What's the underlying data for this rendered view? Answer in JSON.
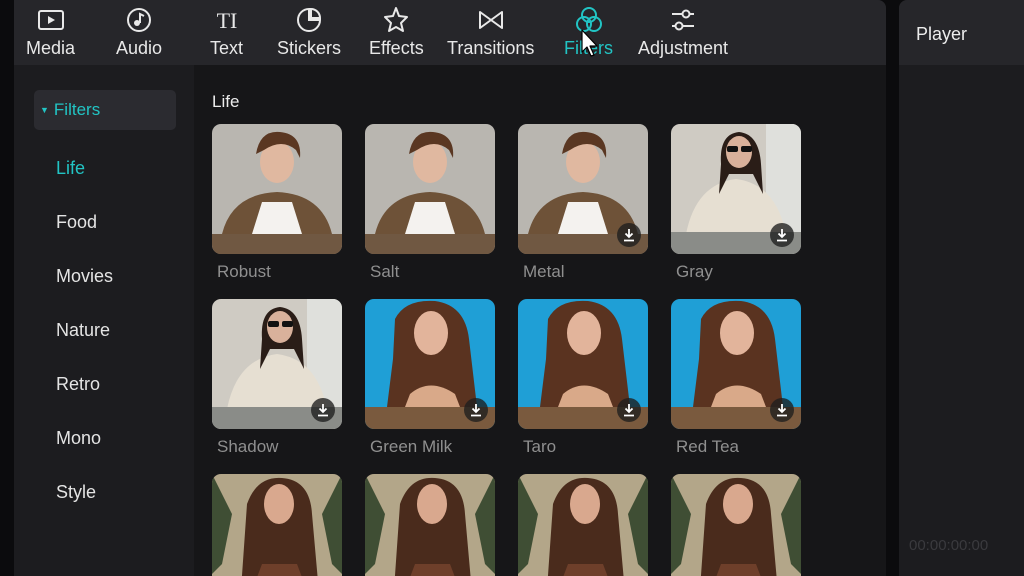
{
  "toolbar": {
    "tabs": [
      {
        "label": "Media",
        "icon": "media-icon"
      },
      {
        "label": "Audio",
        "icon": "audio-icon"
      },
      {
        "label": "Text",
        "icon": "text-icon"
      },
      {
        "label": "Stickers",
        "icon": "stickers-icon"
      },
      {
        "label": "Effects",
        "icon": "effects-icon"
      },
      {
        "label": "Transitions",
        "icon": "transitions-icon"
      },
      {
        "label": "Filters",
        "icon": "filters-icon",
        "active": true
      },
      {
        "label": "Adjustment",
        "icon": "adjustment-icon"
      }
    ],
    "text_icon_glyph": "TI"
  },
  "sidebar": {
    "header": "Filters",
    "items": [
      "Life",
      "Food",
      "Movies",
      "Nature",
      "Retro",
      "Mono",
      "Style"
    ],
    "active": "Life"
  },
  "content": {
    "section_title": "Life",
    "filters": [
      {
        "name": "Robust",
        "download": false
      },
      {
        "name": "Salt",
        "download": false
      },
      {
        "name": "Metal",
        "download": true
      },
      {
        "name": "Gray",
        "download": true
      },
      {
        "name": "Shadow",
        "download": true
      },
      {
        "name": "Green Milk",
        "download": true
      },
      {
        "name": "Taro",
        "download": true
      },
      {
        "name": "Red Tea",
        "download": true
      },
      {
        "name": "",
        "download": false
      },
      {
        "name": "",
        "download": false
      },
      {
        "name": "",
        "download": false
      },
      {
        "name": "",
        "download": false
      }
    ]
  },
  "player": {
    "title": "Player",
    "timecode": "00:00:00:00"
  },
  "colors": {
    "accent": "#22c4c4",
    "panel": "#1c1c1f",
    "toolbar": "#26262a"
  }
}
